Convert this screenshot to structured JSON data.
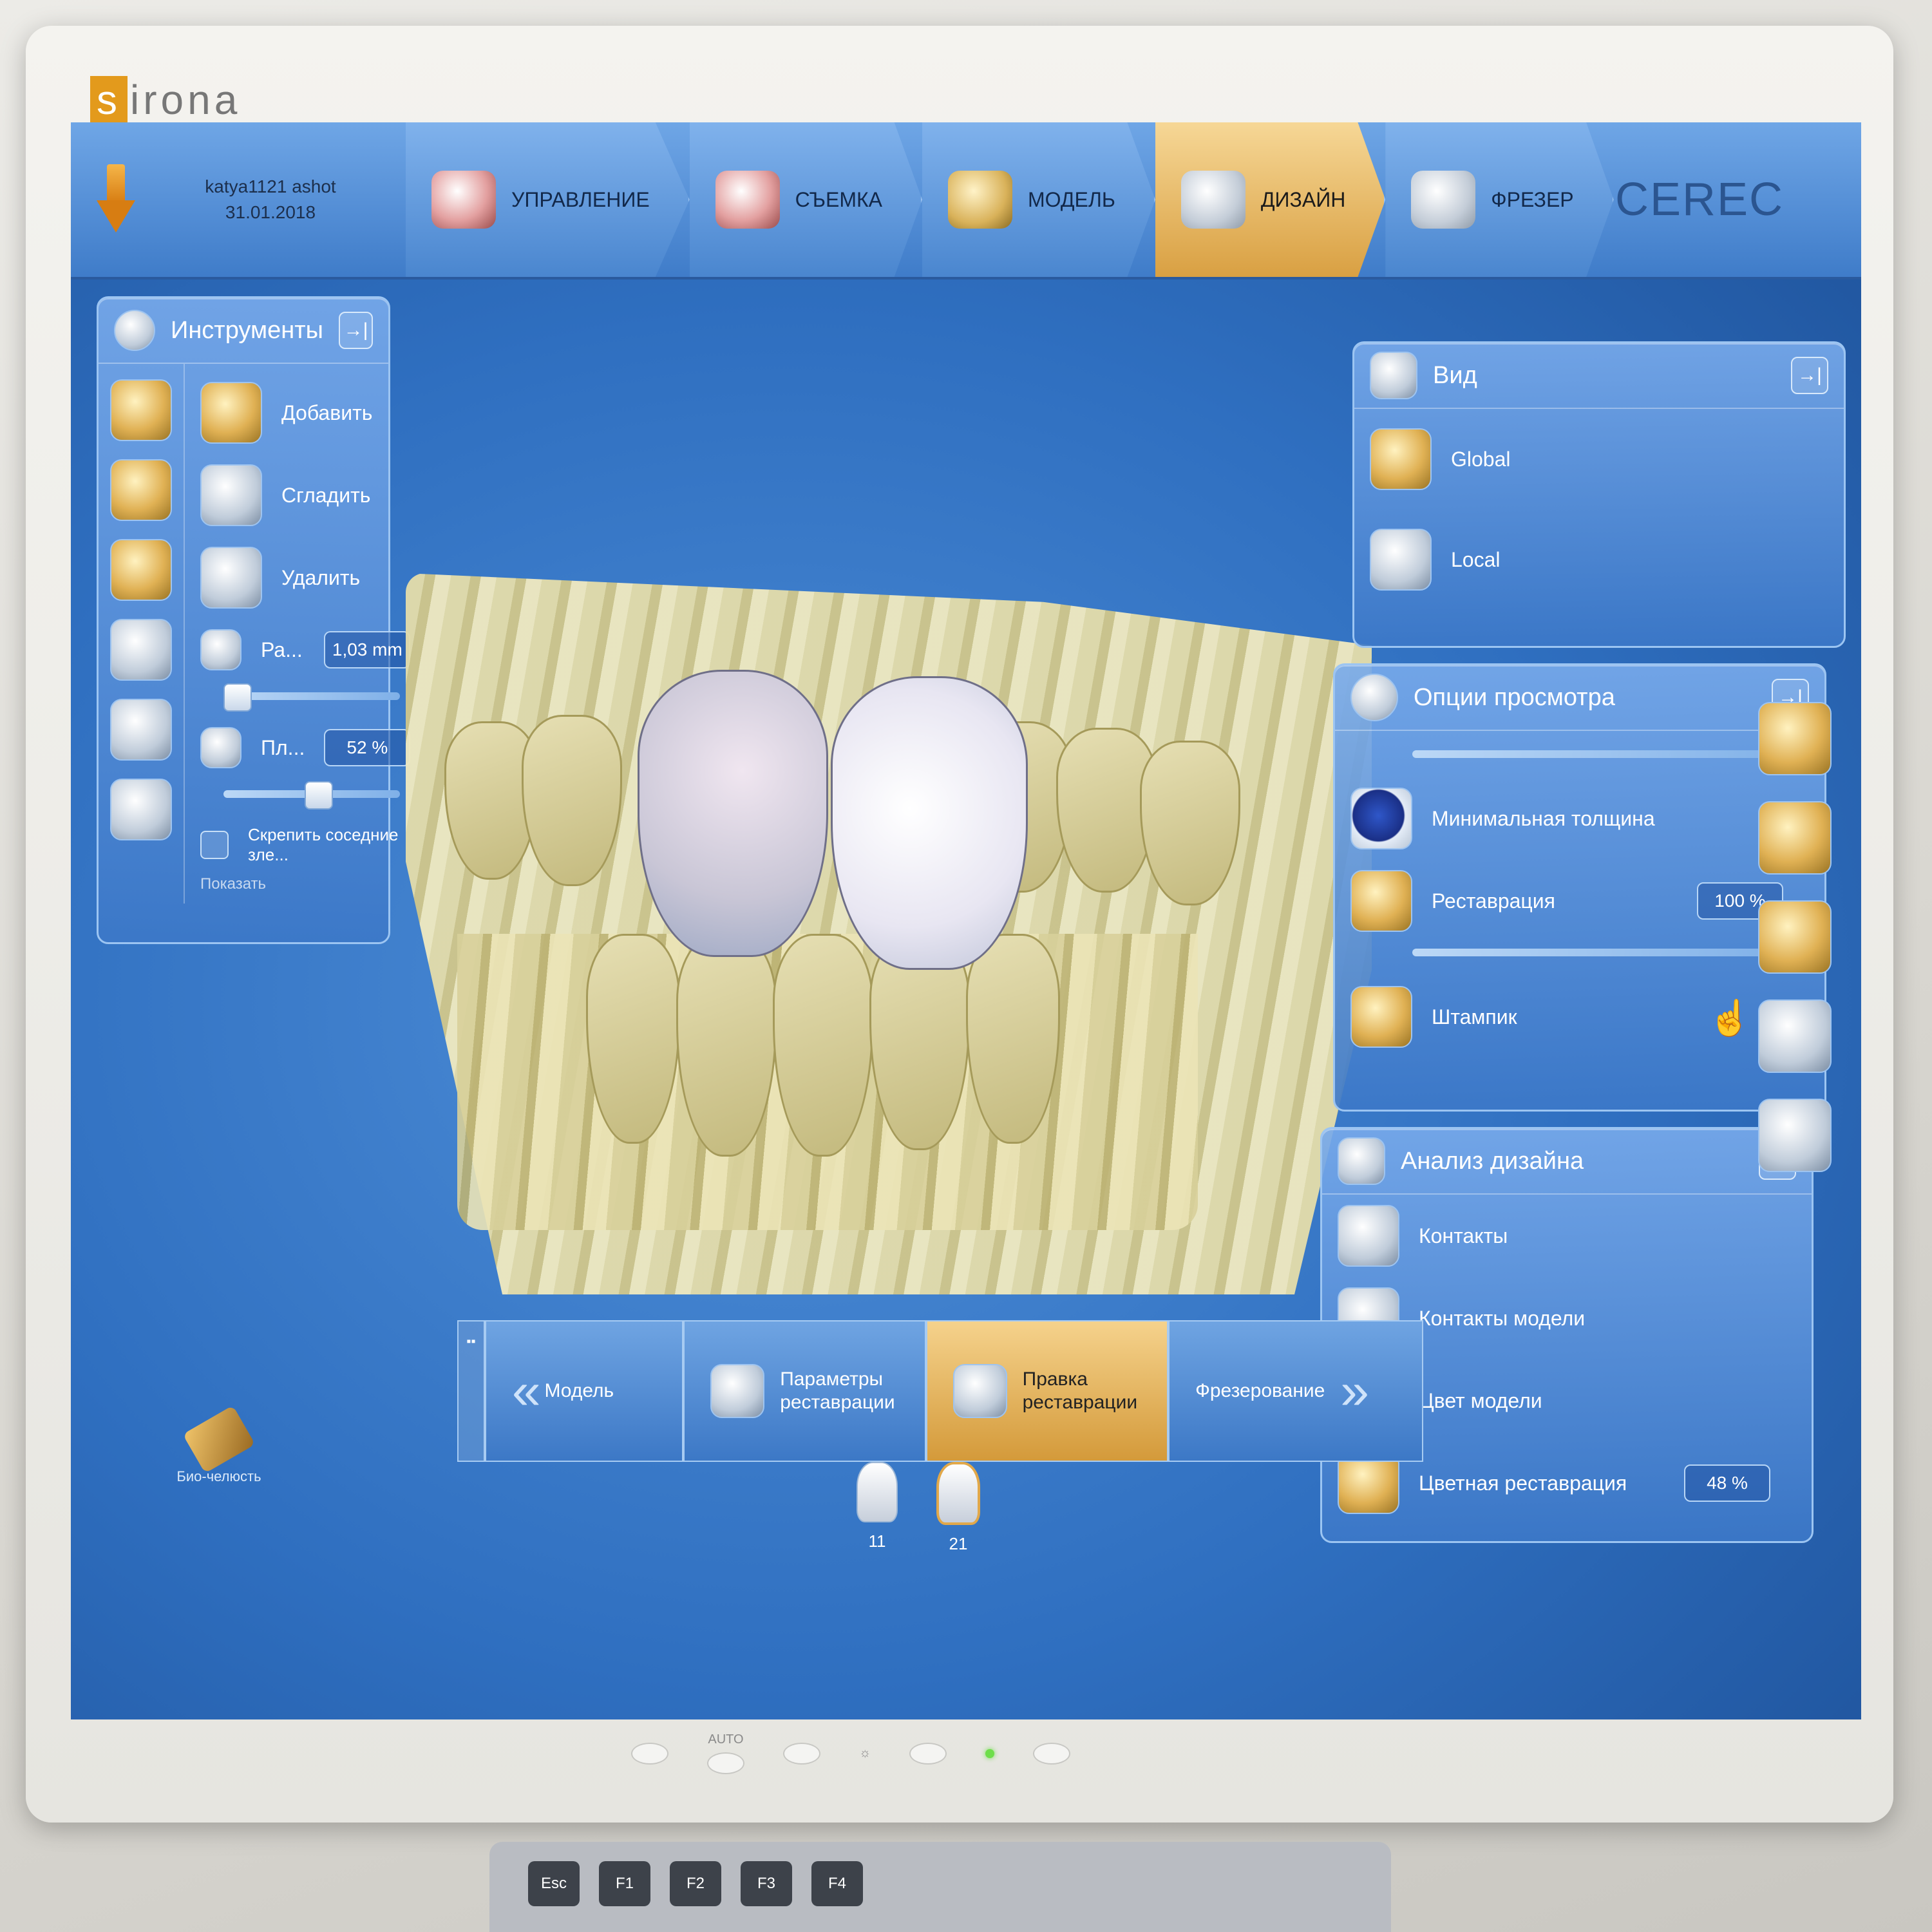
{
  "brand": {
    "logo": "sirona",
    "product": "CEREC"
  },
  "patient": {
    "name": "katya1121 ashot",
    "date": "31.01.2018"
  },
  "workflow": [
    {
      "label": "УПРАВЛЕНИЕ",
      "icon": "jaw-icon",
      "active": false
    },
    {
      "label": "СЪЕМКА",
      "icon": "scan-jaw-icon",
      "active": false
    },
    {
      "label": "МОДЕЛЬ",
      "icon": "model-icon",
      "active": false
    },
    {
      "label": "ДИЗАЙН",
      "icon": "crown-design-icon",
      "active": true
    },
    {
      "label": "ФРЕЗЕР",
      "icon": "mill-icon",
      "active": false
    }
  ],
  "tools": {
    "title": "Инструменты",
    "items": [
      {
        "label": "Добавить",
        "icon": "add-material-icon"
      },
      {
        "label": "Сгладить",
        "icon": "smooth-icon"
      },
      {
        "label": "Удалить",
        "icon": "remove-material-icon"
      }
    ],
    "size": {
      "label": "Ра...",
      "value": "1,03 mm"
    },
    "strength": {
      "label": "Пл...",
      "value": "52 %"
    },
    "checkbox": {
      "label": "Скрепить соседние зле...",
      "checked": false
    },
    "cut_label": "Показать"
  },
  "view_panel": {
    "title": "Вид",
    "items": [
      {
        "label": "Global",
        "icon": "global-jaw-icon"
      },
      {
        "label": "Local",
        "icon": "local-tooth-icon"
      }
    ]
  },
  "view_options": {
    "title": "Опции просмотра",
    "items": [
      {
        "label": "Минимальная толщина",
        "icon": "min-thickness-icon"
      },
      {
        "label": "Реставрация",
        "value": "100 %",
        "icon": "restoration-icon",
        "level": 1.0
      },
      {
        "label": "Штампик",
        "icon": "die-icon"
      }
    ]
  },
  "design_analysis": {
    "title": "Анализ дизайна",
    "items": [
      {
        "label": "Контакты",
        "icon": "contacts-icon"
      },
      {
        "label": "Контакты модели",
        "icon": "model-contacts-icon"
      },
      {
        "label": "Цвет модели",
        "icon": "model-color-icon"
      },
      {
        "label": "Цветная реставрация",
        "value": "48 %",
        "icon": "color-restoration-icon"
      }
    ]
  },
  "bottom_nav": {
    "back": "Модель",
    "params": "Параметры реставрации",
    "edit": "Правка реставрации",
    "next": "Фрезерование"
  },
  "teeth": [
    {
      "num": "11",
      "selected": false
    },
    {
      "num": "21",
      "selected": true
    }
  ],
  "bio_jaw": "Био-челюсть",
  "monitor": {
    "auto_label": "AUTO",
    "brightness": "☼"
  },
  "keyboard": [
    "Esc",
    "F1",
    "F2",
    "F3",
    "F4"
  ]
}
